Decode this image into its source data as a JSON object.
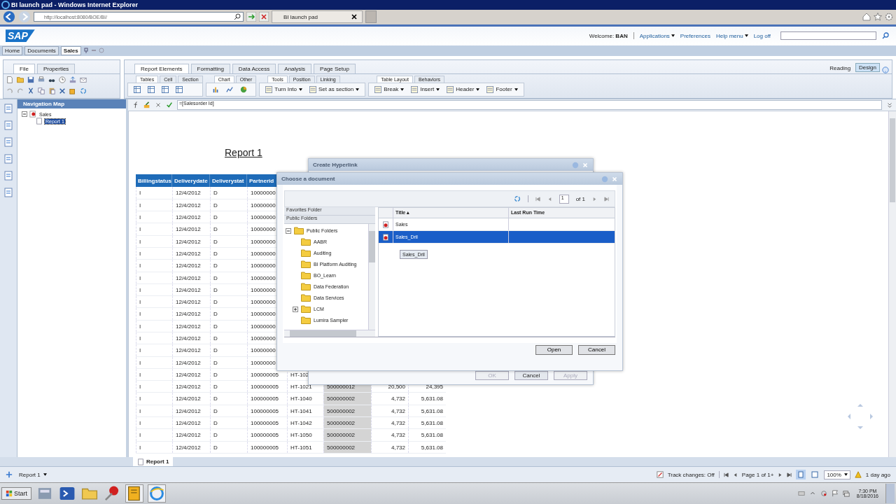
{
  "window": {
    "title": "BI launch pad - Windows Internet Explorer"
  },
  "browser": {
    "url": "http://localhost:8080/BOE/BI/",
    "tab": "BI launch pad"
  },
  "header": {
    "logo": "SAP",
    "welcome": "Welcome: **BAN**",
    "links": [
      {
        "label": "Applications",
        "menu": true
      },
      {
        "label": "Preferences",
        "menu": false
      },
      {
        "label": "Help menu",
        "menu": true
      },
      {
        "label": "Log off",
        "menu": false
      }
    ]
  },
  "doc_tabs": [
    {
      "label": "Home",
      "selected": false
    },
    {
      "label": "Documents",
      "selected": false
    },
    {
      "label": "Sales",
      "selected": true
    }
  ],
  "left_tabs": [
    {
      "label": "File",
      "selected": true
    },
    {
      "label": "Properties",
      "selected": false
    }
  ],
  "ribbon_tabs": [
    {
      "label": "Report Elements",
      "selected": true
    },
    {
      "label": "Formatting",
      "selected": false
    },
    {
      "label": "Data Access",
      "selected": false
    },
    {
      "label": "Analysis",
      "selected": false
    },
    {
      "label": "Page Setup",
      "selected": false
    }
  ],
  "sub_tab_groups": [
    [
      {
        "label": "Tables",
        "selected": true
      },
      {
        "label": "Cell",
        "selected": false
      },
      {
        "label": "Section",
        "selected": false
      }
    ],
    [
      {
        "label": "Chart",
        "selected": true
      },
      {
        "label": "Other",
        "selected": false
      }
    ],
    [
      {
        "label": "Tools",
        "selected": true
      },
      {
        "label": "Position",
        "selected": false
      },
      {
        "label": "Linking",
        "selected": false
      }
    ],
    [
      {
        "label": "Table Layout",
        "selected": true
      },
      {
        "label": "Behaviors",
        "selected": false
      }
    ]
  ],
  "tool_buttons": [
    {
      "label": "Turn Into"
    },
    {
      "label": "Set as section"
    },
    {
      "label": "Break"
    },
    {
      "label": "Insert"
    },
    {
      "label": "Header"
    },
    {
      "label": "Footer"
    }
  ],
  "modes": [
    {
      "label": "Reading",
      "selected": false
    },
    {
      "label": "Design",
      "selected": true
    }
  ],
  "nav": {
    "title": "Navigation Map",
    "tree": [
      {
        "label": "Sales",
        "selected": false,
        "children": [
          {
            "label": "Report 1",
            "selected": true
          }
        ]
      }
    ]
  },
  "formula": "=[Salesorder Id]",
  "report": {
    "title": "Report 1",
    "columns": [
      "Billingstatus",
      "Deliverydate",
      "Deliverystat",
      "Partnerid"
    ],
    "rows": [
      [
        "I",
        "12/4/2012",
        "D",
        "10000000"
      ],
      [
        "I",
        "12/4/2012",
        "D",
        "10000000"
      ],
      [
        "I",
        "12/4/2012",
        "D",
        "10000000"
      ],
      [
        "I",
        "12/4/2012",
        "D",
        "10000000"
      ],
      [
        "I",
        "12/4/2012",
        "D",
        "10000000"
      ],
      [
        "I",
        "12/4/2012",
        "D",
        "10000000"
      ],
      [
        "I",
        "12/4/2012",
        "D",
        "10000000"
      ],
      [
        "I",
        "12/4/2012",
        "D",
        "10000000"
      ],
      [
        "I",
        "12/4/2012",
        "D",
        "10000000"
      ],
      [
        "I",
        "12/4/2012",
        "D",
        "10000000"
      ],
      [
        "I",
        "12/4/2012",
        "D",
        "10000000"
      ],
      [
        "I",
        "12/4/2012",
        "D",
        "10000000"
      ],
      [
        "I",
        "12/4/2012",
        "D",
        "10000000"
      ],
      [
        "I",
        "12/4/2012",
        "D",
        "10000000"
      ],
      [
        "I",
        "12/4/2012",
        "D",
        "10000000"
      ],
      [
        "I",
        "12/4/2012",
        "D",
        "100000005",
        "HT-102"
      ],
      [
        "I",
        "12/4/2012",
        "D",
        "100000005",
        "HT-1021",
        "500000012",
        "20,500",
        "24,395"
      ],
      [
        "I",
        "12/4/2012",
        "D",
        "100000005",
        "HT-1040",
        "500000002",
        "4,732",
        "5,631.08"
      ],
      [
        "I",
        "12/4/2012",
        "D",
        "100000005",
        "HT-1041",
        "500000002",
        "4,732",
        "5,631.08"
      ],
      [
        "I",
        "12/4/2012",
        "D",
        "100000005",
        "HT-1042",
        "500000002",
        "4,732",
        "5,631.08"
      ],
      [
        "I",
        "12/4/2012",
        "D",
        "100000005",
        "HT-1050",
        "500000002",
        "4,732",
        "5,631.08"
      ],
      [
        "I",
        "12/4/2012",
        "D",
        "100000005",
        "HT-1051",
        "500000002",
        "4,732",
        "5,631.08"
      ]
    ]
  },
  "hyperlink_dialog": {
    "title": "Create Hyperlink",
    "buttons": [
      {
        "label": "OK",
        "disabled": true
      },
      {
        "label": "Cancel",
        "disabled": false
      },
      {
        "label": "Apply",
        "disabled": true
      }
    ]
  },
  "choose_dialog": {
    "title": "Choose a document",
    "page": "1",
    "page_of": "of 1",
    "folder_headers": [
      "Favorites Folder",
      "Public Folders"
    ],
    "folders": [
      {
        "label": "Public Folders",
        "expanded": true,
        "children": [
          {
            "label": "AABR",
            "collapsed": false
          },
          {
            "label": "Auditing",
            "collapsed": false
          },
          {
            "label": "BI Platform Auditing",
            "collapsed": false
          },
          {
            "label": "BO_Learn",
            "collapsed": false
          },
          {
            "label": "Data Federation",
            "collapsed": false
          },
          {
            "label": "Data Services",
            "collapsed": false
          },
          {
            "label": "LCM",
            "collapsed": true
          },
          {
            "label": "Lumira Sampler",
            "collapsed": false
          }
        ]
      }
    ],
    "columns": [
      "Title ▴",
      "Last Run Time"
    ],
    "docs": [
      {
        "title": "Sales",
        "selected": false
      },
      {
        "title": "Sales_Dril",
        "selected": true
      }
    ],
    "tooltip": "Sales_Dril",
    "buttons": [
      "Open",
      "Cancel"
    ]
  },
  "report_tabs": [
    {
      "label": "Report 1",
      "selected": true
    }
  ],
  "status": {
    "report": "Report 1",
    "track": "Track changes: Off",
    "page": "Page 1 of 1+",
    "zoom": "100%",
    "updated": "1 day ago"
  },
  "taskbar": {
    "start": "Start",
    "time": "7:30 PM",
    "date": "8/18/2016"
  }
}
